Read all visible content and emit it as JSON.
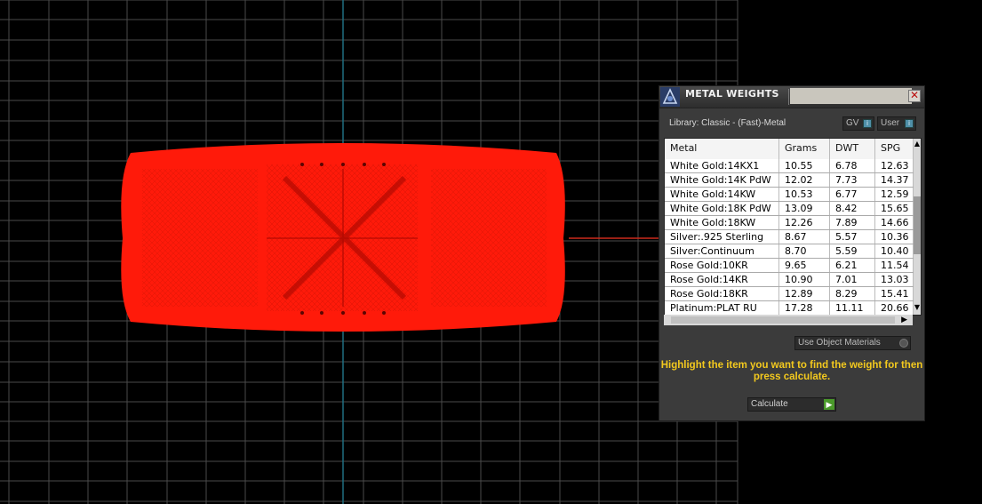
{
  "panel": {
    "title": "METAL WEIGHTS",
    "library_label": "Library: Classic - (Fast)-Metal",
    "toggle_gv": "GV",
    "toggle_user": "User",
    "columns": [
      "Metal",
      "Grams",
      "DWT",
      "SPG"
    ],
    "rows": [
      [
        "White Gold:14KX1",
        "10.55",
        "6.78",
        "12.63"
      ],
      [
        "White Gold:14K PdW",
        "12.02",
        "7.73",
        "14.37"
      ],
      [
        "White Gold:14KW",
        "10.53",
        "6.77",
        "12.59"
      ],
      [
        "White Gold:18K PdW",
        "13.09",
        "8.42",
        "15.65"
      ],
      [
        "White Gold:18KW",
        "12.26",
        "7.89",
        "14.66"
      ],
      [
        "Silver:.925 Sterling",
        "8.67",
        "5.57",
        "10.36"
      ],
      [
        "Silver:Continuum",
        "8.70",
        "5.59",
        "10.40"
      ],
      [
        "Rose Gold:10KR",
        "9.65",
        "6.21",
        "11.54"
      ],
      [
        "Rose Gold:14KR",
        "10.90",
        "7.01",
        "13.03"
      ],
      [
        "Rose Gold:18KR",
        "12.89",
        "8.29",
        "15.41"
      ],
      [
        "Platinum:PLAT RU",
        "17.28",
        "11.11",
        "20.66"
      ]
    ],
    "use_object_materials": "Use Object Materials",
    "hint": "Highlight the item you want to find the weight for then press calculate.",
    "calculate_label": "Calculate"
  },
  "colors": {
    "viewport_bg": "#000000",
    "grid_line": "#4a4a4a",
    "axis_line": "#1f6e80",
    "model_red": "#ff1a0a",
    "hint_yellow": "#f3c91e"
  }
}
